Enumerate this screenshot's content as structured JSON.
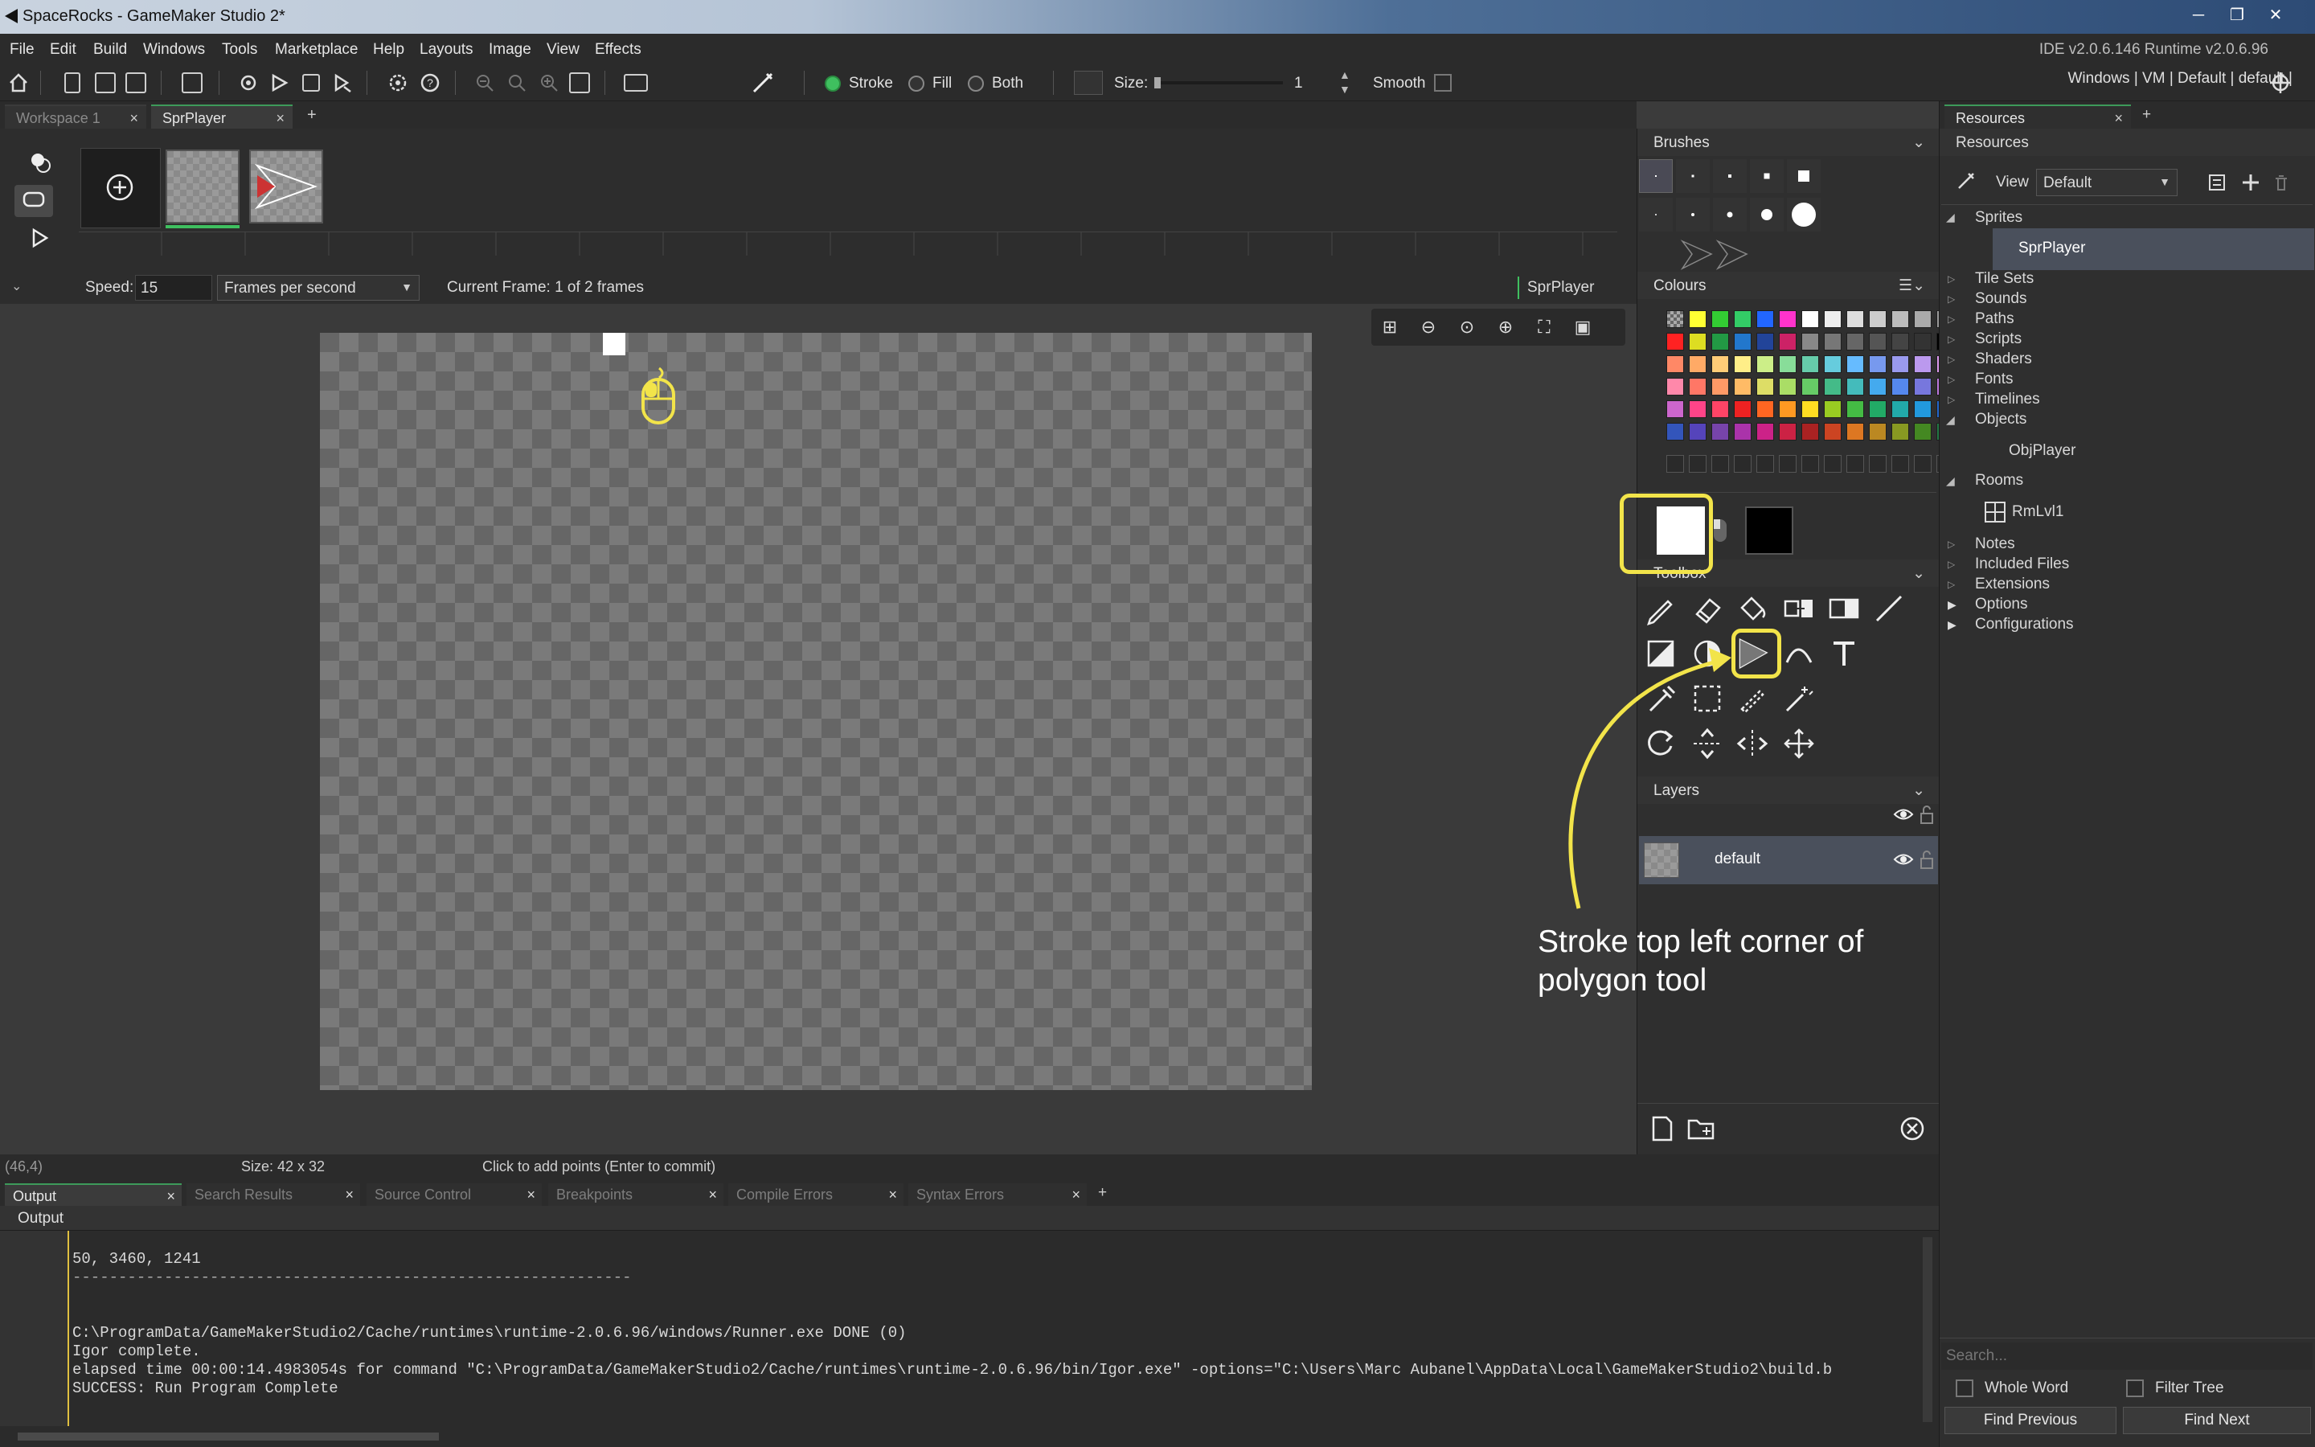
{
  "window": {
    "title": "SpaceRocks - GameMaker Studio 2*"
  },
  "menu": {
    "items": [
      "File",
      "Edit",
      "Build",
      "Windows",
      "Tools",
      "Marketplace",
      "Help",
      "Layouts",
      "Image",
      "View",
      "Effects"
    ],
    "version": "IDE v2.0.6.146 Runtime v2.0.6.96"
  },
  "toolbar": {
    "stroke": "Stroke",
    "fill": "Fill",
    "both": "Both",
    "size_label": "Size:",
    "size_value": "1",
    "smooth": "Smooth",
    "target": "Windows | VM | Default | default |"
  },
  "tabs": {
    "workspace": "Workspace 1",
    "sprite": "SprPlayer",
    "add": "+"
  },
  "animation": {
    "speed_label": "Speed:",
    "speed_value": "15",
    "speed_unit": "Frames per second",
    "current_frame": "Current Frame: 1 of 2 frames",
    "sprite_name": "SprPlayer"
  },
  "status": {
    "coords": "(46,4)",
    "size": "Size: 42 x 32",
    "hint": "Click to add points (Enter to commit)"
  },
  "output_tabs": [
    "Output",
    "Search Results",
    "Source Control",
    "Breakpoints",
    "Compile Errors",
    "Syntax Errors"
  ],
  "output": {
    "header": "Output",
    "lines": [
      "50, 3460, 1241",
      "-------------------------------------------------------------",
      "",
      "",
      "C:\\ProgramData/GameMakerStudio2/Cache/runtimes\\runtime-2.0.6.96/windows/Runner.exe DONE (0)",
      "Igor complete.",
      "elapsed time 00:00:14.4983054s for command \"C:\\ProgramData/GameMakerStudio2/Cache/runtimes\\runtime-2.0.6.96/bin/Igor.exe\" -options=\"C:\\Users\\Marc Aubanel\\AppData\\Local\\GameMakerStudio2\\build.b",
      "SUCCESS: Run Program Complete"
    ]
  },
  "panels": {
    "brushes": "Brushes",
    "colours": "Colours",
    "toolbox": "Toolbox",
    "layers": "Layers",
    "layer_name": "default"
  },
  "palette": [
    [
      "checker",
      "#ffff33",
      "#33cc33",
      "#33cc66",
      "#2266ff",
      "#ff33cc",
      "#ffffff",
      "#eeeeee",
      "#dddddd",
      "#cccccc",
      "#bbbbbb",
      "#aaaaaa",
      "#999999"
    ],
    [
      "#ff2222",
      "#dddd22",
      "#229944",
      "#2277cc",
      "#224499",
      "#cc2266",
      "#888888",
      "#777777",
      "#666666",
      "#555555",
      "#444444",
      "#333333",
      "#000000"
    ],
    [
      "#ff8866",
      "#ffaa66",
      "#ffcc77",
      "#ffee88",
      "#ccee88",
      "#88dd99",
      "#66ccaa",
      "#66ccdd",
      "#66bbff",
      "#7799ee",
      "#9999ee",
      "#bb99ee",
      "#dd99ee"
    ],
    [
      "#ff88aa",
      "#ff7766",
      "#ff9966",
      "#ffbb66",
      "#dddd66",
      "#aadd66",
      "#66cc66",
      "#44bb88",
      "#44bbbb",
      "#44aaee",
      "#5588ee",
      "#7777dd",
      "#bb77dd"
    ],
    [
      "#cc66cc",
      "#ff4488",
      "#ff4466",
      "#ee2222",
      "#ff6622",
      "#ff9922",
      "#ffdd22",
      "#99cc22",
      "#44bb44",
      "#22aa66",
      "#22aaaa",
      "#2299dd",
      "#2266cc"
    ],
    [
      "#3355bb",
      "#5544bb",
      "#7744aa",
      "#aa33aa",
      "#cc2288",
      "#cc2244",
      "#aa2222",
      "#cc4422",
      "#dd7722",
      "#bb8822",
      "#889922",
      "#448822",
      "#227744"
    ]
  ],
  "colors": {
    "primary": "#ffffff",
    "secondary": "#000000",
    "accent_green": "#3fbf5f",
    "annotation": "#f2e44a"
  },
  "resources": {
    "tab": "Resources",
    "header": "Resources",
    "view_label": "View",
    "view_value": "Default",
    "tree": {
      "sprites": "Sprites",
      "spr_player": "SprPlayer",
      "tile_sets": "Tile Sets",
      "sounds": "Sounds",
      "paths": "Paths",
      "scripts": "Scripts",
      "shaders": "Shaders",
      "fonts": "Fonts",
      "timelines": "Timelines",
      "objects": "Objects",
      "obj_player": "ObjPlayer",
      "rooms": "Rooms",
      "rm_lvl1": "RmLvl1",
      "notes": "Notes",
      "included_files": "Included Files",
      "extensions": "Extensions",
      "options": "Options",
      "configurations": "Configurations"
    },
    "search_placeholder": "Search...",
    "whole_word": "Whole Word",
    "filter_tree": "Filter Tree",
    "find_previous": "Find Previous",
    "find_next": "Find Next"
  },
  "annotation": {
    "text": "Stroke top left corner of polygon tool"
  },
  "icons": [
    "home-icon",
    "new-icon",
    "open-icon",
    "save-icon",
    "export-icon",
    "build-icon",
    "run-icon",
    "stop-icon",
    "debug-icon",
    "settings-icon",
    "help-icon",
    "zoom-out-icon",
    "zoom-reset-icon",
    "zoom-in-icon",
    "device-icon",
    "monitor-icon",
    "brush-tool-icon",
    "pencil-icon",
    "eraser-icon",
    "fill-icon",
    "polygon-icon",
    "line-icon",
    "text-icon",
    "eyedropper-icon",
    "select-icon",
    "magic-wand-icon",
    "rotate-icon",
    "flip-icon",
    "mirror-icon",
    "move-icon",
    "eye-icon",
    "lock-icon",
    "mouse-icon",
    "target-icon"
  ]
}
